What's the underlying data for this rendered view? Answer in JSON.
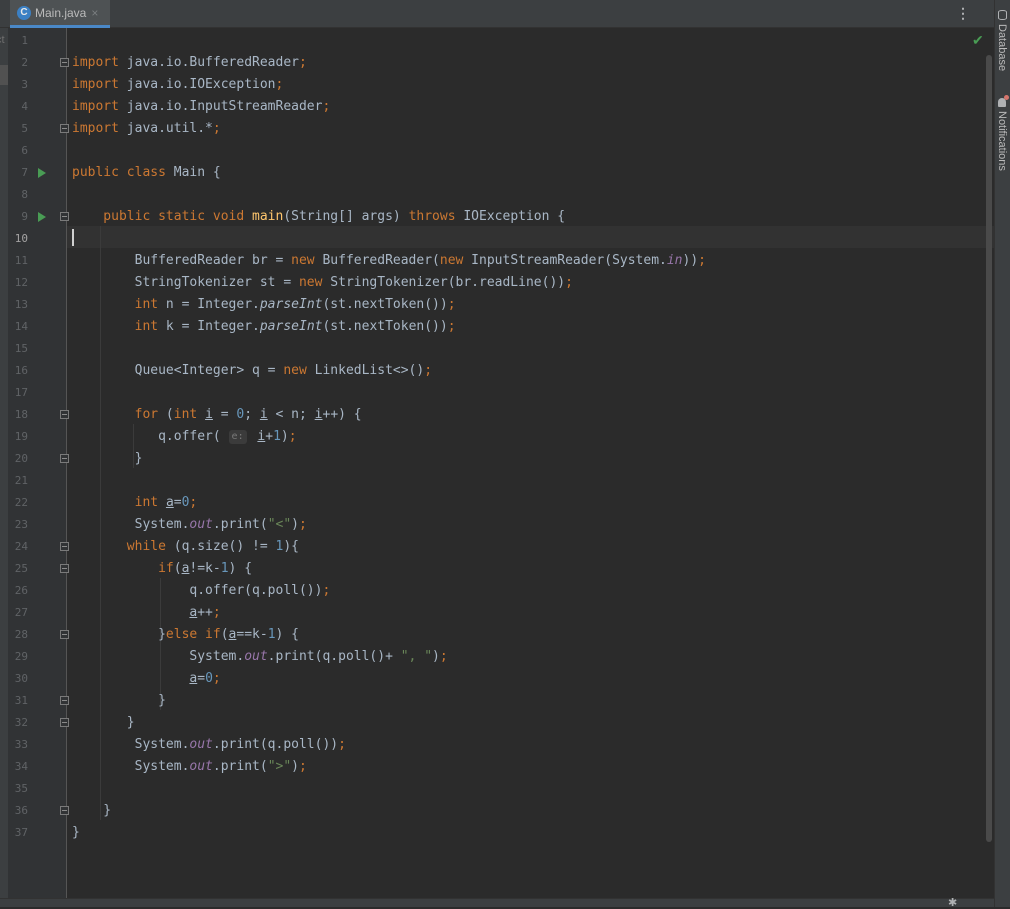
{
  "tab": {
    "icon": "java-class-icon",
    "filename": "Main.java",
    "close": "×"
  },
  "left_strip": {
    "label": "ct"
  },
  "editor": {
    "current_line": "10",
    "line_numbers": [
      "1",
      "2",
      "3",
      "4",
      "5",
      "6",
      "7",
      "8",
      "9",
      "10",
      "11",
      "12",
      "13",
      "14",
      "15",
      "16",
      "17",
      "18",
      "19",
      "20",
      "21",
      "22",
      "23",
      "24",
      "25",
      "26",
      "27",
      "28",
      "29",
      "30",
      "31",
      "32",
      "33",
      "34",
      "35",
      "36",
      "37"
    ],
    "code": {
      "l2": [
        "import",
        " java.io.BufferedReader",
        ";"
      ],
      "l3": [
        "import",
        " java.io.IOException",
        ";"
      ],
      "l4": [
        "import",
        " java.io.InputStreamReader",
        ";"
      ],
      "l5": [
        "import",
        " java.util.*",
        ";"
      ],
      "l7": [
        "public class",
        " Main {"
      ],
      "l9": [
        "    public static void ",
        "main",
        "(String[] args) ",
        "throws",
        " IOException {"
      ],
      "l11": [
        "        BufferedReader br = ",
        "new",
        " BufferedReader(",
        "new",
        " InputStreamReader(System.",
        "in",
        "))",
        ";"
      ],
      "l12": [
        "        StringTokenizer st = ",
        "new",
        " StringTokenizer(br.readLine())",
        ";"
      ],
      "l13": [
        "        ",
        "int",
        " n = Integer.",
        "parseInt",
        "(st.nextToken())",
        ";"
      ],
      "l14": [
        "        ",
        "int",
        " k = Integer.",
        "parseInt",
        "(st.nextToken())",
        ";"
      ],
      "l16": [
        "        Queue<Integer> q = ",
        "new",
        " LinkedList<>()",
        ";"
      ],
      "l18": [
        "        ",
        "for",
        " (",
        "int",
        " ",
        "i",
        " = ",
        "0",
        "; ",
        "i",
        " < n; ",
        "i",
        "++) {"
      ],
      "l19": [
        "           q.offer( ",
        "e:",
        " ",
        "i",
        "+",
        "1",
        ")",
        ";"
      ],
      "l20": [
        "        }"
      ],
      "l22": [
        "        ",
        "int",
        " ",
        "a",
        "=",
        "0",
        ";"
      ],
      "l23": [
        "        System.",
        "out",
        ".print(",
        "\"<\"",
        ")",
        ";"
      ],
      "l24": [
        "       ",
        "while",
        " (q.size() != ",
        "1",
        "){"
      ],
      "l25": [
        "           ",
        "if",
        "(",
        "a",
        "!=k-",
        "1",
        ") {"
      ],
      "l26": [
        "               q.offer(q.poll())",
        ";"
      ],
      "l27": [
        "               ",
        "a",
        "++",
        ";"
      ],
      "l28": [
        "           }",
        "else if",
        "(",
        "a",
        "==k-",
        "1",
        ") {"
      ],
      "l29": [
        "               System.",
        "out",
        ".print(q.poll()+ ",
        "\", \"",
        ")",
        ";"
      ],
      "l30": [
        "               ",
        "a",
        "=",
        "0",
        ";"
      ],
      "l31": [
        "           }"
      ],
      "l32": [
        "       }"
      ],
      "l33": [
        "        System.",
        "out",
        ".print(q.poll())",
        ";"
      ],
      "l34": [
        "        System.",
        "out",
        ".print(",
        "\">\"",
        ")",
        ";"
      ],
      "l36": [
        "    }"
      ],
      "l37": [
        "}"
      ]
    }
  },
  "right_panels": {
    "database": "Database",
    "notifications": "Notifications"
  },
  "status": {
    "inspection": "no-problems-check-icon"
  }
}
